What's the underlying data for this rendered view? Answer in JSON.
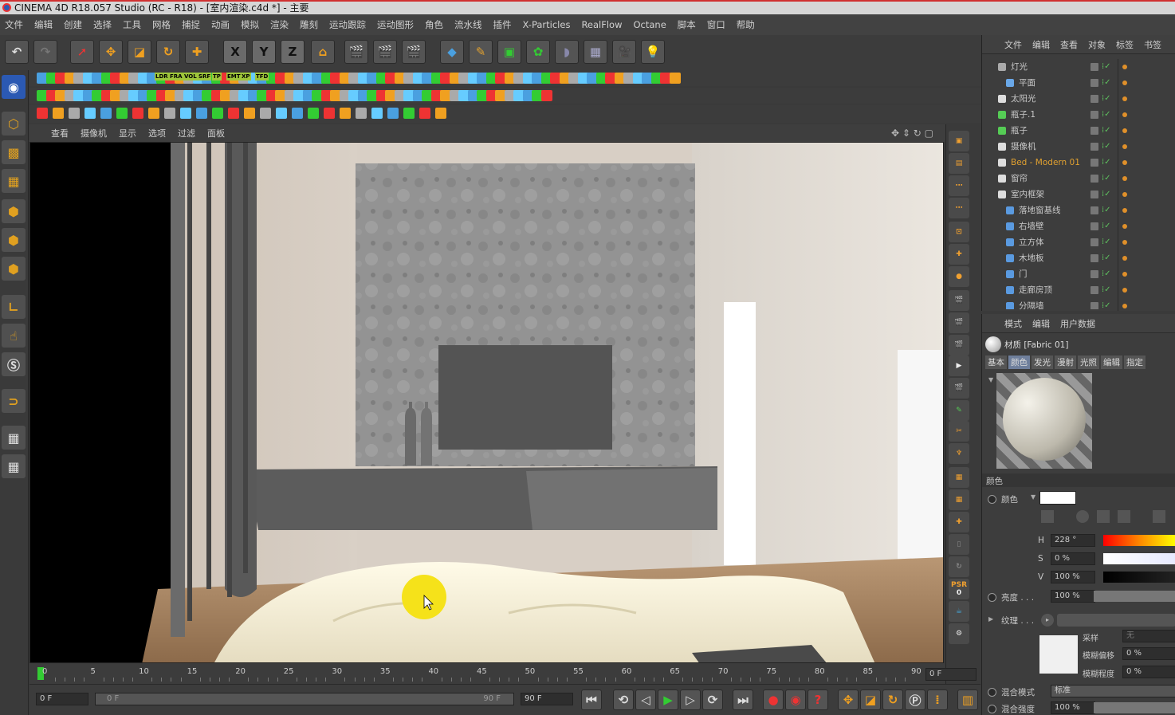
{
  "window": {
    "title": "CINEMA 4D R18.057 Studio (RC - R18) - [室内渲染.c4d *] - 主要"
  },
  "menu": [
    "文件",
    "编辑",
    "创建",
    "选择",
    "工具",
    "网格",
    "捕捉",
    "动画",
    "模拟",
    "渲染",
    "雕刻",
    "运动跟踪",
    "运动图形",
    "角色",
    "流水线",
    "插件",
    "X-Particles",
    "RealFlow",
    "Octane",
    "脚本",
    "窗口",
    "帮助"
  ],
  "toolbar": {
    "x_label": "X",
    "y_label": "Y",
    "z_label": "Z"
  },
  "small_toolbar_labels": [
    "LDR",
    "FRA",
    "VOL",
    "SRF",
    "TP",
    "EMT",
    "XP",
    "TFD"
  ],
  "viewport_menu": [
    "查看",
    "摄像机",
    "显示",
    "选项",
    "过滤",
    "面板"
  ],
  "timeline": {
    "ticks": [
      "0",
      "5",
      "10",
      "15",
      "20",
      "25",
      "30",
      "35",
      "40",
      "45",
      "50",
      "55",
      "60",
      "65",
      "70",
      "75",
      "80",
      "85",
      "90"
    ],
    "current_frame": "0 F"
  },
  "playbar": {
    "start": "0 F",
    "range_start": "0 F",
    "range_end": "90 F",
    "end": "90 F"
  },
  "right_tools": {
    "psr_label": "PSR",
    "psr_value": "0"
  },
  "object_manager": {
    "menu": [
      "文件",
      "编辑",
      "查看",
      "对象",
      "标签",
      "书签"
    ],
    "objects": [
      {
        "name": "灯光",
        "indent": 0
      },
      {
        "name": "平面",
        "indent": 1
      },
      {
        "name": "太阳光",
        "indent": 0
      },
      {
        "name": "瓶子.1",
        "indent": 0
      },
      {
        "name": "瓶子",
        "indent": 0
      },
      {
        "name": "摄像机",
        "indent": 0
      },
      {
        "name": "Bed - Modern 01",
        "indent": 0,
        "highlight": true
      },
      {
        "name": "窗帘",
        "indent": 0
      },
      {
        "name": "室内框架",
        "indent": 0
      },
      {
        "name": "落地窗基线",
        "indent": 1
      },
      {
        "name": "右墙壁",
        "indent": 1
      },
      {
        "name": "立方体",
        "indent": 1
      },
      {
        "name": "木地板",
        "indent": 1
      },
      {
        "name": "门",
        "indent": 1
      },
      {
        "name": "走廊房顶",
        "indent": 1
      },
      {
        "name": "分隔墙",
        "indent": 1
      }
    ]
  },
  "attribute_manager": {
    "menu": [
      "模式",
      "编辑",
      "用户数据"
    ],
    "material_title": "材质 [Fabric 01]",
    "tabs": [
      "基本",
      "颜色",
      "发光",
      "漫射",
      "光照",
      "编辑",
      "指定"
    ],
    "active_tab": "颜色",
    "section": "颜色",
    "color_label": "颜色",
    "h_label": "H",
    "h_value": "228 °",
    "s_label": "S",
    "s_value": "0 %",
    "v_label": "V",
    "v_value": "100 %",
    "brightness_label": "亮度 . . .",
    "brightness_value": "100 %",
    "texture_label": "纹理 . . .",
    "sampling_label": "采样",
    "sampling_value": "无",
    "blur_offset_label": "模糊偏移",
    "blur_offset_value": "0 %",
    "blur_scale_label": "模糊程度",
    "blur_scale_value": "0 %",
    "blend_mode_label": "混合模式",
    "blend_mode_value": "标准",
    "blend_strength_label": "混合强度",
    "blend_strength_value": "100 %"
  },
  "colors": {
    "accent": "#6f7f9c",
    "highlight_object": "#e0a030",
    "swatch": "#ffffff"
  }
}
